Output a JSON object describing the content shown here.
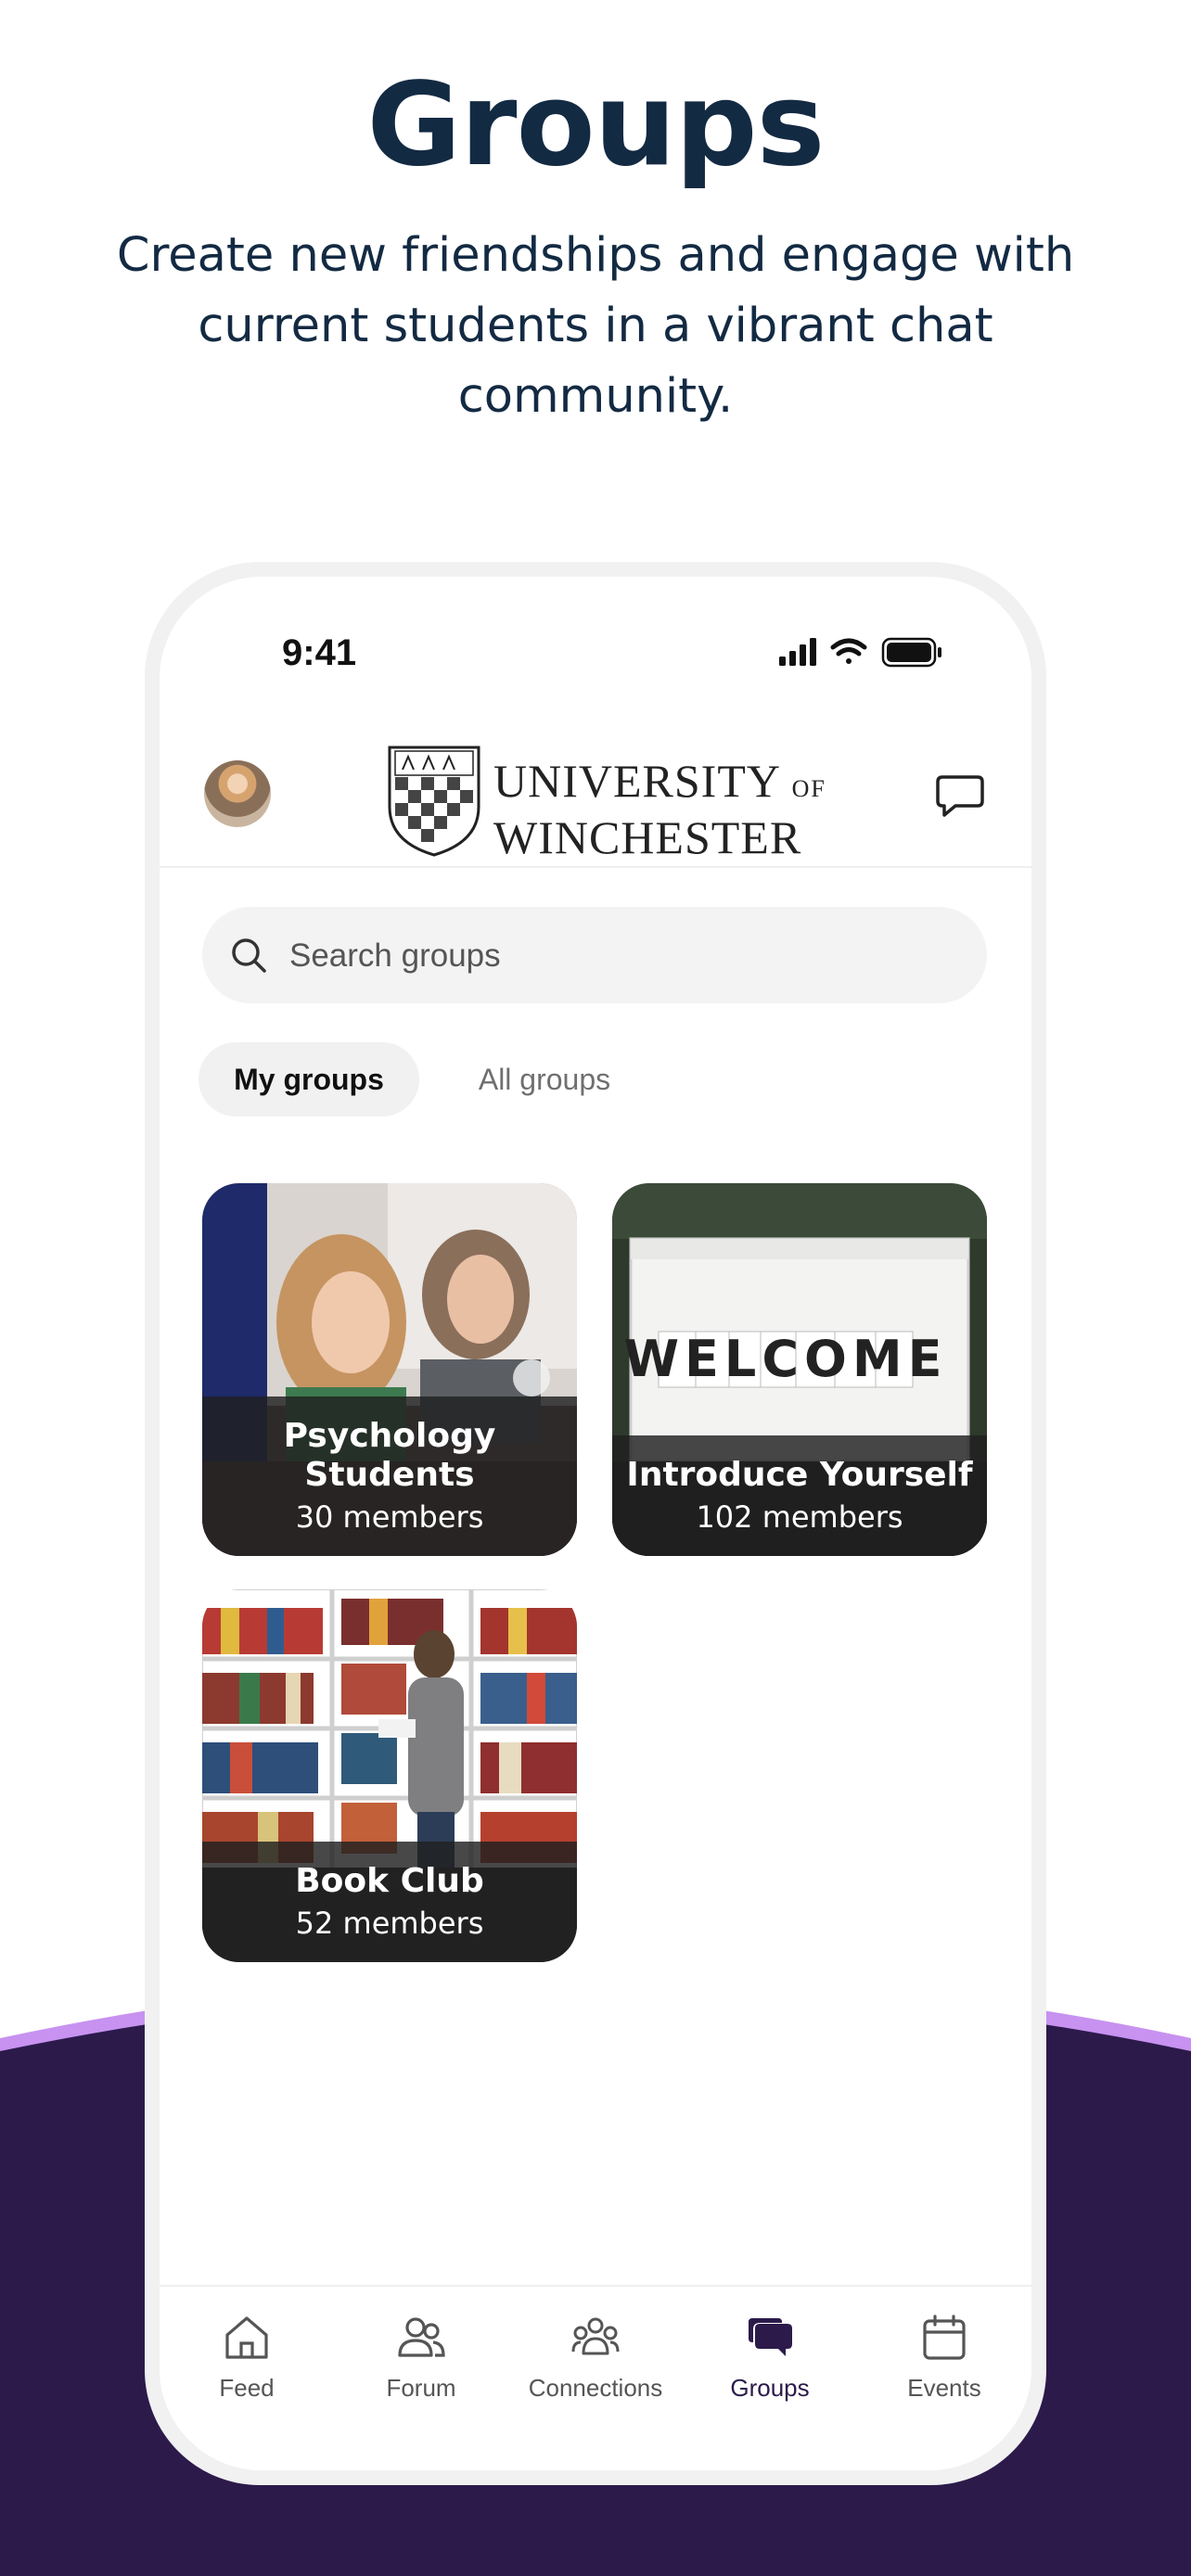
{
  "promo": {
    "title": "Groups",
    "subtitle": "Create new friendships and engage with current students in a vibrant chat community."
  },
  "status_bar": {
    "time": "9:41"
  },
  "header": {
    "logo_line1": "UNIVERSITY",
    "logo_of": "OF",
    "logo_line2": "WINCHESTER"
  },
  "search": {
    "placeholder": "Search groups"
  },
  "tabs": {
    "my_groups": "My groups",
    "all_groups": "All groups",
    "selected": "My groups"
  },
  "groups": [
    {
      "title": "Psychology Students",
      "members": "30 members"
    },
    {
      "title": "Introduce Yourself",
      "members": "102 members"
    },
    {
      "title": "Book Club",
      "members": "52 members"
    }
  ],
  "welcome_sign": "WELCOME",
  "nav": [
    {
      "label": "Feed",
      "icon": "home-icon"
    },
    {
      "label": "Forum",
      "icon": "people-icon"
    },
    {
      "label": "Connections",
      "icon": "connections-icon"
    },
    {
      "label": "Groups",
      "icon": "chat-bubbles-icon",
      "active": true
    },
    {
      "label": "Events",
      "icon": "calendar-icon"
    }
  ],
  "colors": {
    "heading": "#132a43",
    "background_purple": "#2c1a4b",
    "accent_lilac": "#c792f0",
    "active_nav": "#2c1a4b"
  }
}
